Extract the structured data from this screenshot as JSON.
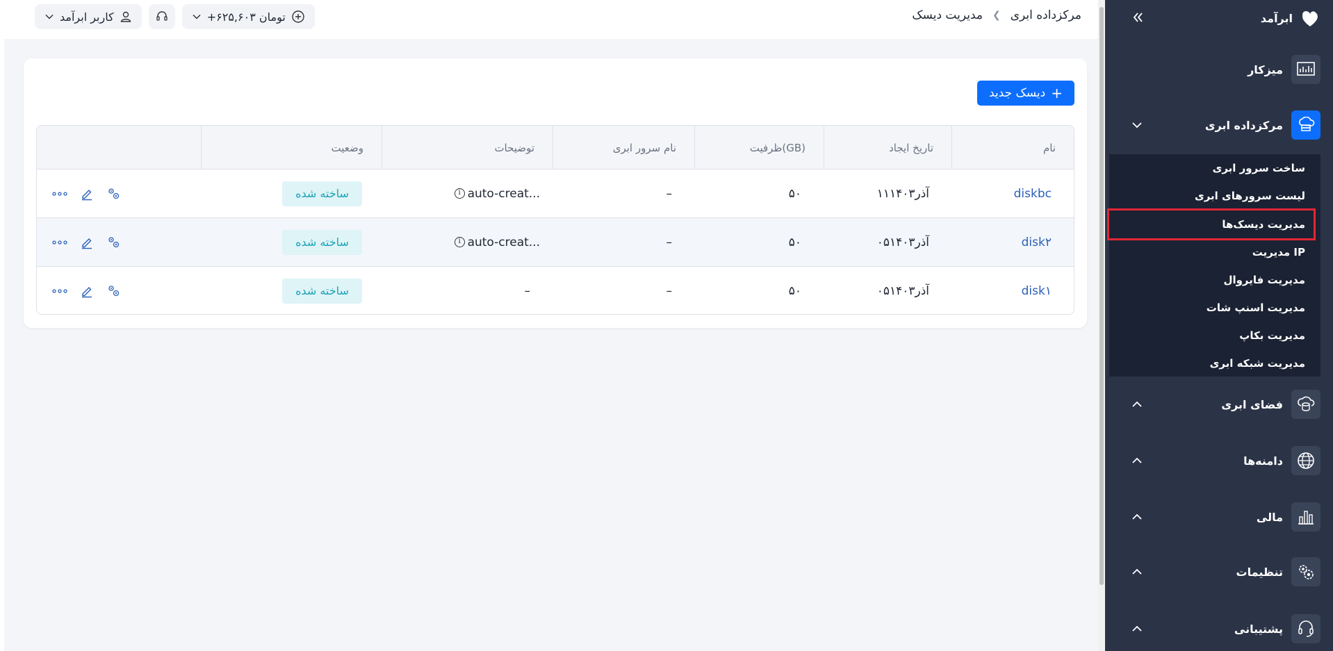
{
  "breadcrumb": {
    "root": "مرکزداده ابری",
    "current": "مدیریت دیسک"
  },
  "topbar": {
    "balance": "+۶۲۵,۶۰۳ تومان",
    "user": "کاربر ابرآمد"
  },
  "toolbar": {
    "new_disk_label": "دیسک جدید"
  },
  "table": {
    "headers": {
      "name": "نام",
      "created": "تاریخ ایجاد",
      "capacity": "ظرفیت(GB)",
      "server": "نام سرور ابری",
      "description": "توضیحات",
      "status": "وضعیت"
    },
    "rows": [
      {
        "name": "diskbc",
        "created": "۱۱آذر۱۴۰۳",
        "capacity": "۵۰",
        "server": "–",
        "description": "auto-creat...",
        "status": "ساخته شده"
      },
      {
        "name": "disk۲",
        "created": "۰۵آذر۱۴۰۳",
        "capacity": "۵۰",
        "server": "–",
        "description": "auto-creat...",
        "status": "ساخته شده"
      },
      {
        "name": "disk۱",
        "created": "۰۵آذر۱۴۰۳",
        "capacity": "۵۰",
        "server": "–",
        "description": "–",
        "status": "ساخته شده"
      }
    ]
  },
  "sidebar": {
    "brand": "ابرآمد",
    "items": {
      "dashboard": "میزکار",
      "datacenter": "مرکزداده ابری",
      "space": "فضای ابری",
      "domains": "دامنه‌ها",
      "finance": "مالی",
      "settings": "تنظیمات",
      "support": "پشتیبانی"
    },
    "submenu": {
      "create_server": "ساخت سرور ابری",
      "server_list": "لیست سرورهای ابری",
      "disk_management": "مدیریت دیسک‌ها",
      "ip_management": "مدیریت IP",
      "firewall": "مدیریت فایروال",
      "snapshot": "مدیریت اسنپ شات",
      "backup": "مدیریت بکاپ",
      "network": "مدیریت شبکه ابری"
    }
  },
  "colors": {
    "accent": "#0d6efd",
    "sidebar_bg": "#2b3447",
    "status_bg": "#dff4f7",
    "status_text": "#1aa3b5",
    "highlight": "#e32636"
  }
}
